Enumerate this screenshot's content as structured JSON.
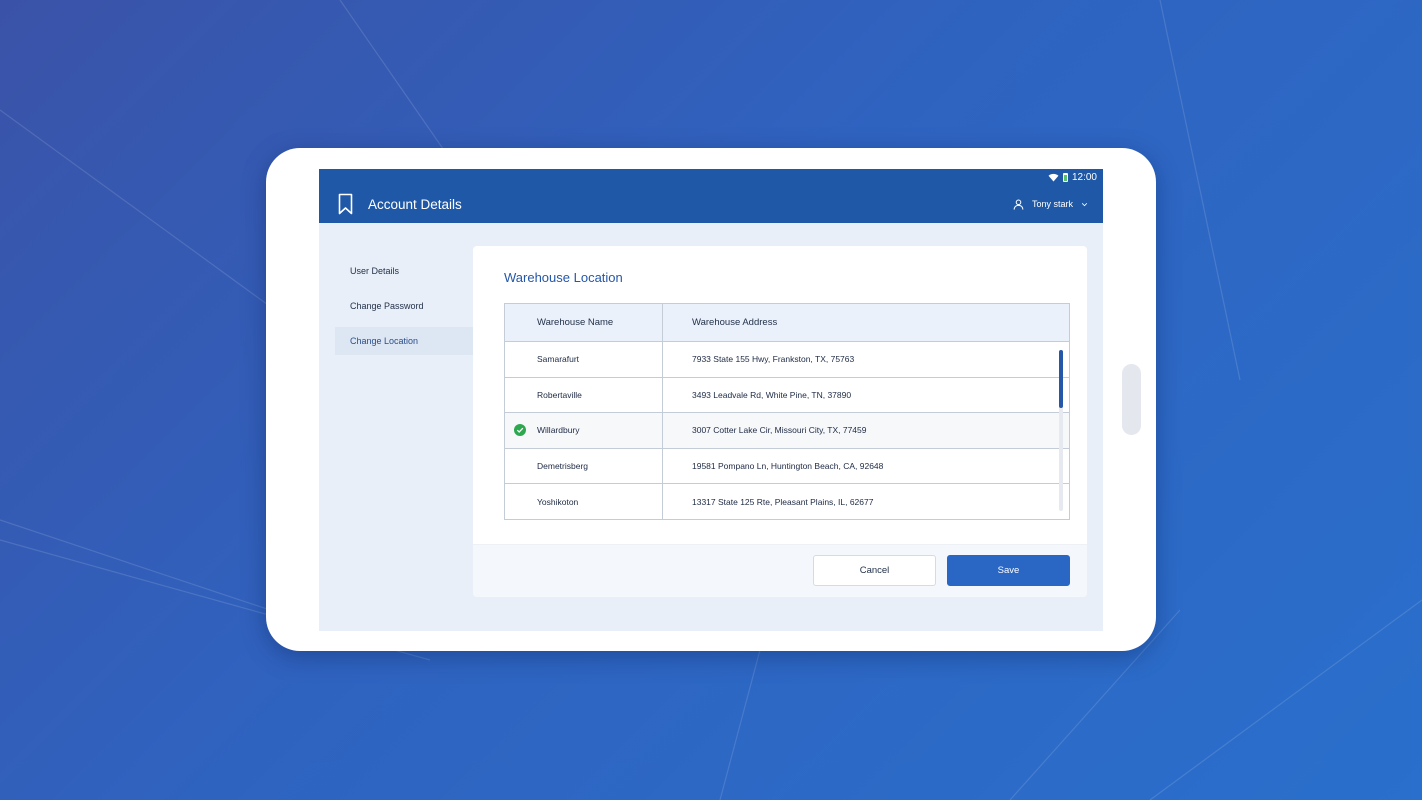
{
  "status_bar": {
    "time": "12:00"
  },
  "app_bar": {
    "title": "Account Details",
    "user_name": "Tony stark"
  },
  "sidebar": {
    "items": [
      {
        "label": "User Details",
        "active": false
      },
      {
        "label": "Change Password",
        "active": false
      },
      {
        "label": "Change Location",
        "active": true
      }
    ]
  },
  "panel": {
    "title": "Warehouse Location",
    "table": {
      "headers": [
        "Warehouse Name",
        "Warehouse Address"
      ],
      "rows": [
        {
          "name": "Samarafurt",
          "address": "7933 State 155 Hwy, Frankston, TX, 75763",
          "selected": false
        },
        {
          "name": "Robertaville",
          "address": "3493 Leadvale Rd, White Pine, TN, 37890",
          "selected": false
        },
        {
          "name": "Willardbury",
          "address": "3007 Cotter Lake Cir, Missouri City, TX, 77459",
          "selected": true
        },
        {
          "name": "Demetrisberg",
          "address": "19581 Pompano Ln, Huntington Beach, CA, 92648",
          "selected": false
        },
        {
          "name": "Yoshikoton",
          "address": "13317 State 125 Rte, Pleasant Plains, IL, 62677",
          "selected": false
        }
      ]
    }
  },
  "buttons": {
    "cancel": "Cancel",
    "save": "Save"
  },
  "colors": {
    "app_bar": "#1f58a6",
    "accent": "#2557a8",
    "save_button": "#2a66c4",
    "check": "#2ea84f"
  }
}
